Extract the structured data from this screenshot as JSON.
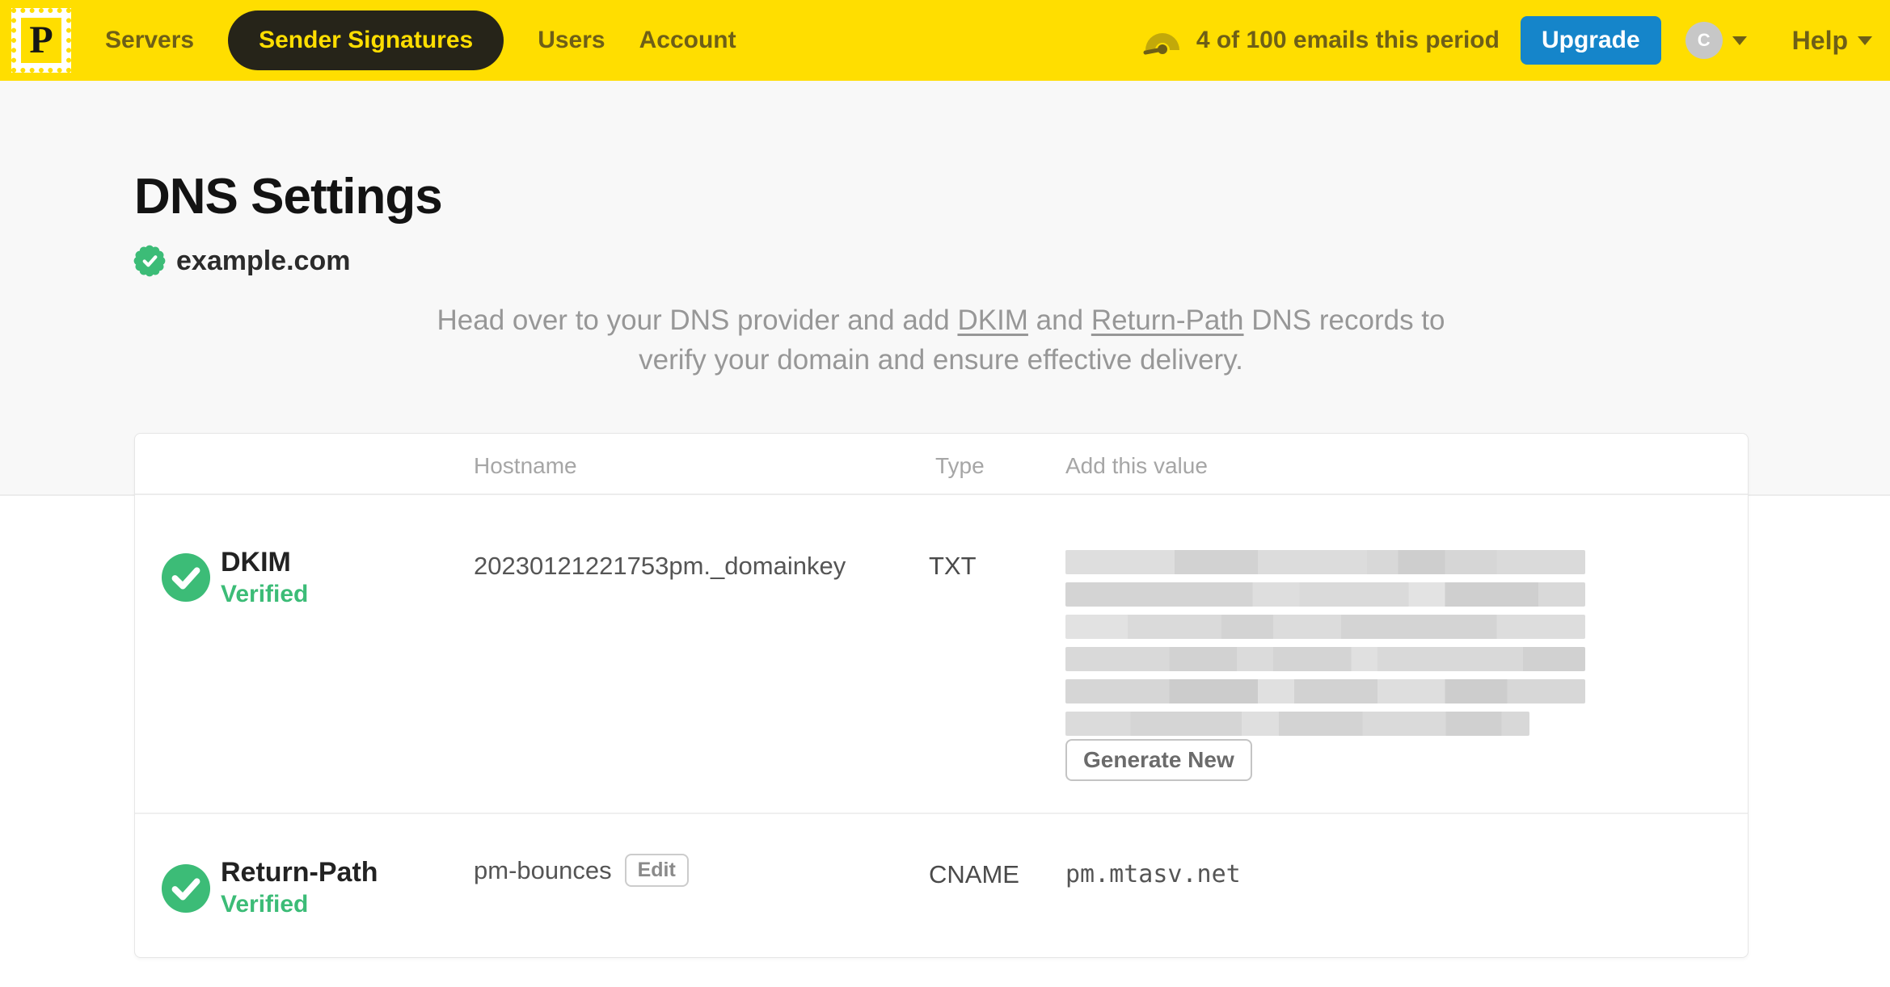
{
  "nav": {
    "logo_letter": "P",
    "items": [
      {
        "label": "Servers",
        "active": false
      },
      {
        "label": "Sender Signatures",
        "active": true
      },
      {
        "label": "Users",
        "active": false
      },
      {
        "label": "Account",
        "active": false
      }
    ],
    "usage_text": "4 of 100 emails this period",
    "upgrade_label": "Upgrade",
    "avatar_letter": "C",
    "help_label": "Help"
  },
  "page": {
    "title": "DNS Settings",
    "domain": "example.com",
    "description": {
      "pre": "Head over to your DNS provider and add ",
      "link1": "DKIM",
      "mid": " and ",
      "link2": "Return-Path",
      "post": " DNS records to verify your domain and ensure effective delivery."
    }
  },
  "table": {
    "headers": {
      "hostname": "Hostname",
      "type": "Type",
      "value": "Add this value"
    },
    "rows": [
      {
        "name": "DKIM",
        "status": "Verified",
        "hostname": "20230121221753pm._domainkey",
        "type": "TXT",
        "value": "(redacted)",
        "action_label": "Generate New"
      },
      {
        "name": "Return-Path",
        "status": "Verified",
        "hostname": "pm-bounces",
        "edit_label": "Edit",
        "type": "CNAME",
        "value": "pm.mtasv.net"
      }
    ]
  },
  "colors": {
    "brand_yellow": "#ffde00",
    "nav_text": "#6e5f17",
    "verified_green": "#3cbc77",
    "upgrade_blue": "#1585ca"
  }
}
